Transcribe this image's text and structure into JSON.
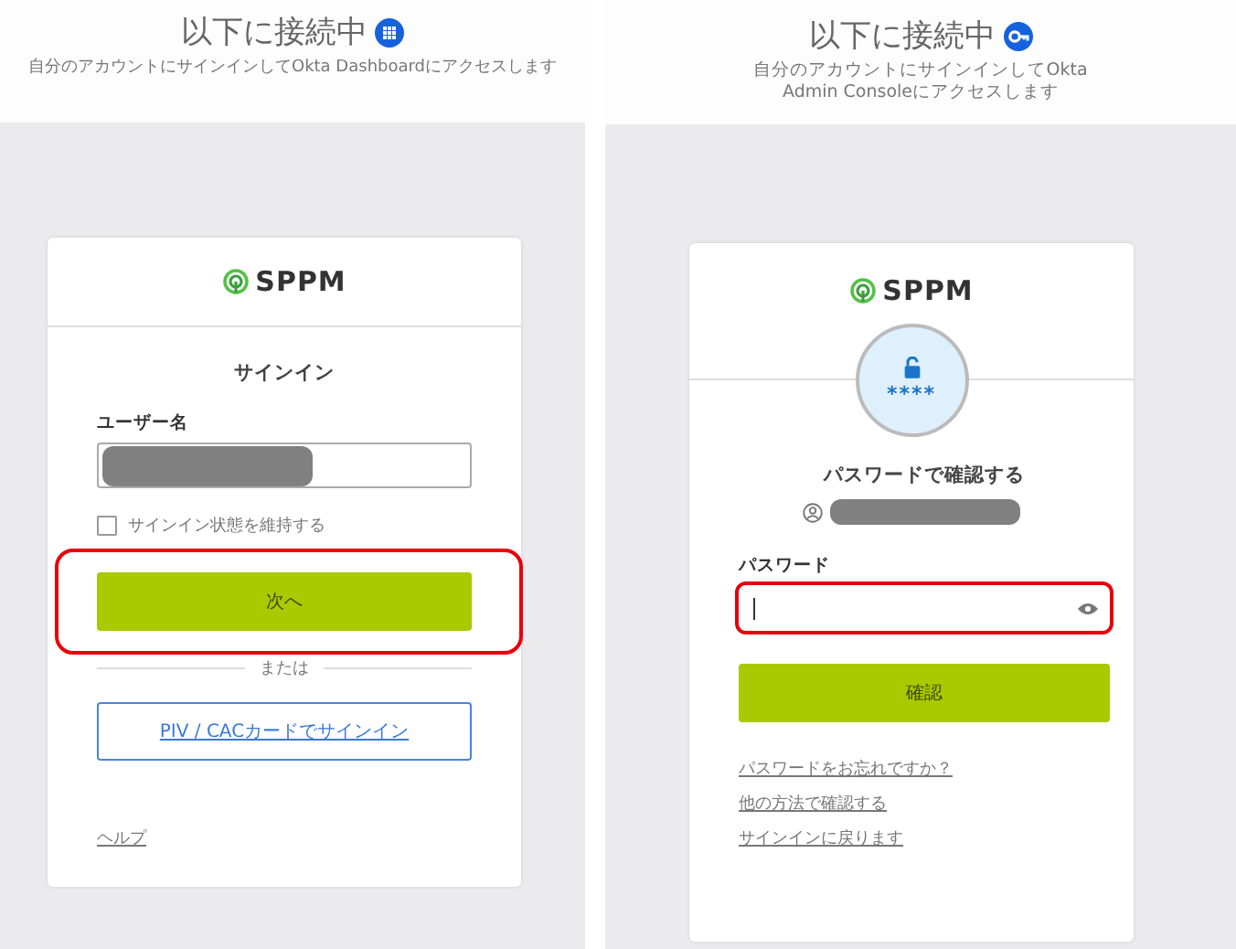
{
  "panels": [
    {
      "header": {
        "title": "以下に接続中",
        "subtitle": "自分のアカウントにサインインしてOkta Dashboardにアクセスします"
      },
      "logo": "SPPM",
      "items": [
        {
          "kind": "heading",
          "text": "サインイン"
        },
        {
          "kind": "field",
          "label": "ユーザー名",
          "redacted": true
        },
        {
          "kind": "checkbox",
          "label": "サインイン状態を維持する",
          "checked": false
        },
        {
          "kind": "button",
          "label": "次へ",
          "highlighted": true
        },
        {
          "kind": "divider",
          "label": "または"
        },
        {
          "kind": "outline-button",
          "label": "PIV / CACカードでサインイン"
        },
        {
          "kind": "link",
          "label": "ヘルプ"
        }
      ]
    },
    {
      "header": {
        "title": "以下に接続中",
        "subtitle": "自分のアカウントにサインインしてOkta Admin Consoleにアクセスします"
      },
      "logo": "SPPM",
      "items": [
        {
          "kind": "badge",
          "text": "****"
        },
        {
          "kind": "heading",
          "text": "パスワードで確認する"
        },
        {
          "kind": "identity",
          "redacted": true
        },
        {
          "kind": "field",
          "label": "パスワード",
          "focused": true,
          "reveal_toggle": true,
          "highlighted": true
        },
        {
          "kind": "button",
          "label": "確認"
        },
        {
          "kind": "link",
          "label": "パスワードをお忘れですか？"
        },
        {
          "kind": "link",
          "label": "他の方法で確認する"
        },
        {
          "kind": "link",
          "label": "サインインに戻ります"
        }
      ]
    }
  ]
}
